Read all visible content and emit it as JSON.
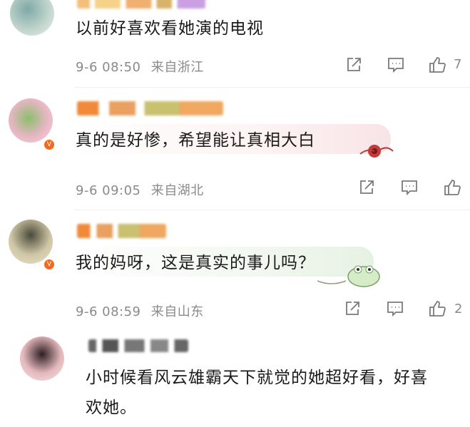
{
  "comments": [
    {
      "text": "以前好喜欢看她演的电视",
      "date": "9-6 08:50",
      "location": "来自浙江",
      "like_count": "7",
      "actions": {
        "repost_icon": "repost-icon",
        "comment_icon": "comment-icon",
        "like_icon": "thumbs-up-icon"
      }
    },
    {
      "text": "真的是好惨，希望能让真相大白",
      "date": "9-6 09:05",
      "location": "来自湖北",
      "like_count": "",
      "actions": {
        "repost_icon": "repost-icon",
        "comment_icon": "comment-icon",
        "like_icon": "thumbs-up-icon"
      }
    },
    {
      "text": "我的妈呀，这是真实的事儿吗？",
      "date": "9-6 08:59",
      "location": "来自山东",
      "like_count": "2",
      "actions": {
        "repost_icon": "repost-icon",
        "comment_icon": "comment-icon",
        "like_icon": "thumbs-up-icon"
      }
    },
    {
      "text_line1": "小时候看风云雄霸天下就觉的她超好看，好喜",
      "text_line2": "欢她。"
    }
  ],
  "colors": {
    "text": "#1a1a1a",
    "meta": "#8a8a8a",
    "badge": "#f26b1d",
    "bubble_pink": "#fbeef0",
    "bubble_green": "#eef6ec"
  }
}
